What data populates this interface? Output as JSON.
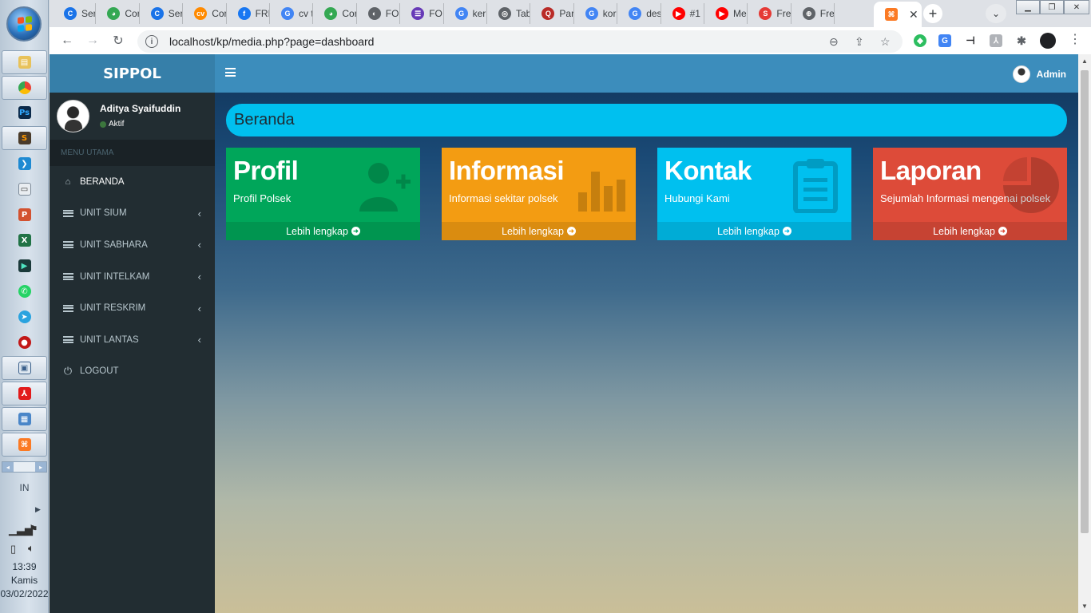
{
  "browser": {
    "tabs": [
      {
        "label": "Ser",
        "color": "#1a73e8",
        "glyph": "C"
      },
      {
        "label": "Cor",
        "color": "#34a853",
        "glyph": "◕"
      },
      {
        "label": "Ser",
        "color": "#1a73e8",
        "glyph": "C"
      },
      {
        "label": "Cor",
        "color": "#ff8a00",
        "glyph": "cv"
      },
      {
        "label": "FRE",
        "color": "#1877f2",
        "glyph": "f"
      },
      {
        "label": "cv t",
        "color": "#4285f4",
        "glyph": "G"
      },
      {
        "label": "Cor",
        "color": "#34a853",
        "glyph": "◕"
      },
      {
        "label": "FOI",
        "color": "#5f6368",
        "glyph": "◐"
      },
      {
        "label": "FOI",
        "color": "#673ab7",
        "glyph": "☰"
      },
      {
        "label": "ker",
        "color": "#4285f4",
        "glyph": "G"
      },
      {
        "label": "Tab",
        "color": "#5f6368",
        "glyph": "◎"
      },
      {
        "label": "Par",
        "color": "#b92b27",
        "glyph": "Q"
      },
      {
        "label": "kor",
        "color": "#4285f4",
        "glyph": "G"
      },
      {
        "label": "des",
        "color": "#4285f4",
        "glyph": "G"
      },
      {
        "label": "#1",
        "color": "#ff0000",
        "glyph": "▶"
      },
      {
        "label": "Me",
        "color": "#ff0000",
        "glyph": "▶"
      },
      {
        "label": "Fre",
        "color": "#e53935",
        "glyph": "S"
      },
      {
        "label": "Fre",
        "color": "#5f6368",
        "glyph": "⊕"
      }
    ],
    "active_tab_favicon_color": "#fb7a24",
    "url": "localhost/kp/media.php?page=dashboard"
  },
  "taskbar": {
    "language": "IN",
    "time": "13:39",
    "day": "Kamis",
    "date": "03/02/2022"
  },
  "sidebar": {
    "logo": "SIPPOL",
    "user_name": "Aditya Syaifuddin",
    "user_status": "Aktif",
    "menu_header": "MENU UTAMA",
    "items": [
      {
        "label": "BERANDA",
        "icon": "home-icon"
      },
      {
        "label": "UNIT SIUM",
        "icon": "list-icon"
      },
      {
        "label": "UNIT SABHARA",
        "icon": "list-icon"
      },
      {
        "label": "UNIT INTELKAM",
        "icon": "list-icon"
      },
      {
        "label": "UNIT RESKRIM",
        "icon": "list-icon"
      },
      {
        "label": "UNIT LANTAS",
        "icon": "list-icon"
      },
      {
        "label": "LOGOUT",
        "icon": "power-icon"
      }
    ]
  },
  "topbar": {
    "admin_label": "Admin"
  },
  "page": {
    "heading": "Beranda",
    "boxes": [
      {
        "title": "Profil",
        "subtitle": "Profil Polsek",
        "link": "Lebih lengkap",
        "color": "#00a65a",
        "icon": "user-plus-icon"
      },
      {
        "title": "Informasi",
        "subtitle": "Informasi sekitar polsek",
        "link": "Lebih lengkap",
        "color": "#f39c12",
        "icon": "bar-chart-icon"
      },
      {
        "title": "Kontak",
        "subtitle": "Hubungi Kami",
        "link": "Lebih lengkap",
        "color": "#00c0ef",
        "icon": "clipboard-icon"
      },
      {
        "title": "Laporan",
        "subtitle": "Sejumlah Informasi mengenai polsek",
        "link": "Lebih lengkap",
        "color": "#dd4b39",
        "icon": "pie-chart-icon"
      }
    ]
  }
}
